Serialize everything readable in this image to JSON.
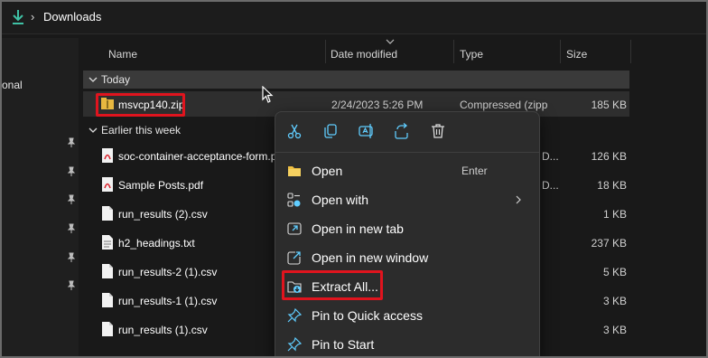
{
  "addressbar": {
    "crumb": "Downloads",
    "separator": "›"
  },
  "sidebar": {
    "partial_label": "onal"
  },
  "columns": {
    "name": "Name",
    "date": "Date modified",
    "type": "Type",
    "size": "Size"
  },
  "groups": [
    {
      "label": "Today"
    },
    {
      "label": "Earlier this week"
    }
  ],
  "files_today": [
    {
      "name": "msvcp140.zip",
      "date": "2/24/2023 5:26 PM",
      "type": "Compressed (zipp...",
      "size": "185 KB"
    }
  ],
  "files_week": [
    {
      "name": "soc-container-acceptance-form.p",
      "type_clip": "D...",
      "size": "126 KB",
      "icon": "pdf-icon"
    },
    {
      "name": "Sample Posts.pdf",
      "type_clip": "D...",
      "size": "18 KB",
      "icon": "pdf-icon"
    },
    {
      "name": "run_results (2).csv",
      "type_clip": "",
      "size": "1 KB",
      "icon": "file-icon"
    },
    {
      "name": "h2_headings.txt",
      "type_clip": "",
      "size": "237 KB",
      "icon": "text-file-icon"
    },
    {
      "name": "run_results-2 (1).csv",
      "type_clip": "",
      "size": "5 KB",
      "icon": "file-icon"
    },
    {
      "name": "run_results-1 (1).csv",
      "type_clip": "",
      "size": "3 KB",
      "icon": "file-icon"
    },
    {
      "name": "run_results (1).csv",
      "type_clip": "",
      "size": "3 KB",
      "icon": "file-icon"
    }
  ],
  "context_menu": {
    "toolbar": [
      "cut-icon",
      "copy-icon",
      "rename-icon",
      "share-icon",
      "delete-icon"
    ],
    "items": [
      {
        "label": "Open",
        "shortcut": "Enter",
        "icon": "folder-icon"
      },
      {
        "label": "Open with",
        "shortcut": "",
        "icon": "open-with-icon",
        "submenu": true
      },
      {
        "label": "Open in new tab",
        "shortcut": "",
        "icon": "new-tab-icon"
      },
      {
        "label": "Open in new window",
        "shortcut": "",
        "icon": "new-window-icon"
      },
      {
        "label": "Extract All...",
        "shortcut": "",
        "icon": "extract-icon"
      },
      {
        "label": "Pin to Quick access",
        "shortcut": "",
        "icon": "pin-icon"
      },
      {
        "label": "Pin to Start",
        "shortcut": "",
        "icon": "pin-icon"
      }
    ]
  },
  "colors": {
    "accent": "#60cdff",
    "highlight_box": "#e0141e",
    "background": "#191919"
  }
}
